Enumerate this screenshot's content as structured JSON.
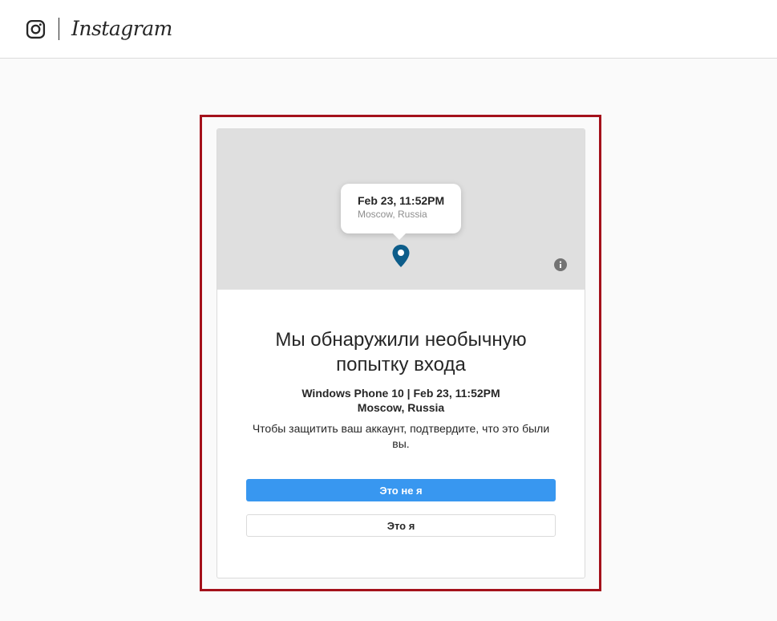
{
  "header": {
    "logo_icon": "instagram-camera-icon",
    "wordmark": "Instagram"
  },
  "map": {
    "date": "Feb 23, 11:52PM",
    "place": "Moscow, Russia",
    "pin_icon": "map-pin-icon",
    "pin_color": "#0d5d8a",
    "info_icon": "info-icon"
  },
  "alert": {
    "heading": "Мы обнаружили необычную попытку входа",
    "device": "Windows Phone 10 | Feb 23, 11:52PM",
    "location": "Moscow, Russia",
    "message": "Чтобы защитить ваш аккаунт, подтвердите, что это были вы."
  },
  "actions": {
    "not_me_label": "Это не я",
    "me_label": "Это я"
  },
  "colors": {
    "primary": "#3897f0",
    "highlight_border": "#a4111b",
    "background": "#fafafa"
  }
}
